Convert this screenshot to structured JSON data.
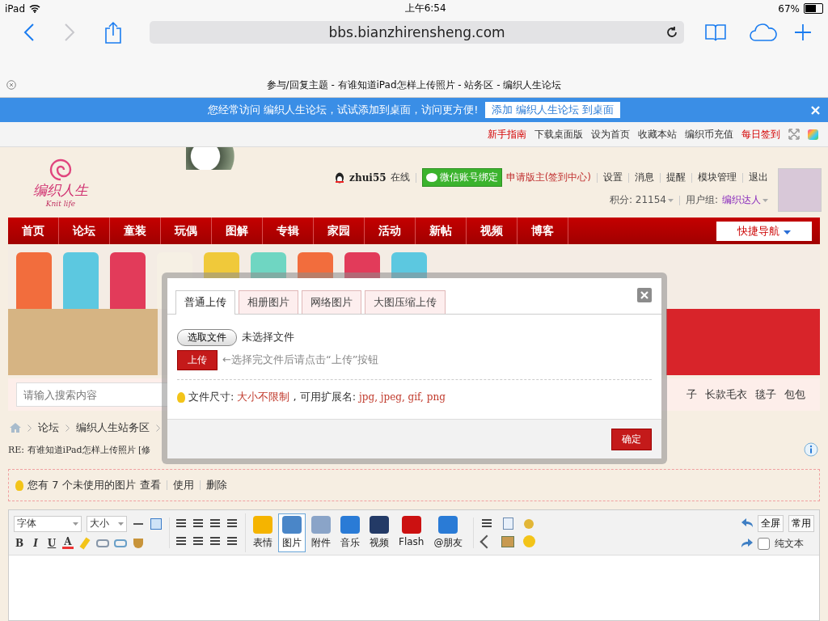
{
  "status_bar": {
    "device": "iPad",
    "time": "上午6:54",
    "battery": "67%"
  },
  "browser": {
    "url": "bbs.bianzhirensheng.com",
    "page_title": "参与/回复主题 - 有谁知道iPad怎样上传照片 - 站务区 - 编织人生论坛"
  },
  "add_prompt": {
    "text": "您经常访问 编织人生论坛，试试添加到桌面，访问更方便!",
    "button": "添加 编织人生论坛 到桌面"
  },
  "top_links": [
    {
      "label": "新手指南",
      "highlighted": true
    },
    {
      "label": "下载桌面版",
      "highlighted": false
    },
    {
      "label": "设为首页",
      "highlighted": false
    },
    {
      "label": "收藏本站",
      "highlighted": false
    },
    {
      "label": "编织币充值",
      "highlighted": false
    },
    {
      "label": "每日签到",
      "highlighted": true
    }
  ],
  "logo": {
    "title": "编织人生",
    "subtitle": "Knit life"
  },
  "user": {
    "name": "zhui55",
    "status": "在线",
    "wechat": "微信账号绑定",
    "links": [
      "申请版主(签到中心)",
      "设置",
      "消息",
      "提醒",
      "模块管理",
      "退出"
    ],
    "points": "积分: 21154",
    "group_label": "用户组:",
    "group": "编织达人"
  },
  "nav": {
    "items": [
      "首页",
      "论坛",
      "童装",
      "玩偶",
      "图解",
      "专辑",
      "家园",
      "活动",
      "新帖",
      "视频",
      "博客"
    ],
    "quick": "快捷导航"
  },
  "search": {
    "placeholder": "请输入搜索内容",
    "tags": [
      "子",
      "长款毛衣",
      "毯子",
      "包包"
    ]
  },
  "breadcrumb": [
    "论坛",
    "编织人生站务区"
  ],
  "post_title": "RE: 有谁知道iPad怎样上传照片 [修",
  "notice": {
    "text": "您有 7 个未使用的图片",
    "actions": [
      "查看",
      "使用",
      "删除"
    ]
  },
  "editor": {
    "font": "字体",
    "size": "大小",
    "format_buttons": [
      "B",
      "I",
      "U",
      "A"
    ],
    "tools": [
      {
        "label": "表情",
        "selected": false
      },
      {
        "label": "图片",
        "selected": true
      },
      {
        "label": "附件",
        "selected": false
      },
      {
        "label": "音乐",
        "selected": false
      },
      {
        "label": "视频",
        "selected": false
      },
      {
        "label": "Flash",
        "selected": false
      },
      {
        "label": "@朋友",
        "selected": false
      }
    ],
    "fullscreen": "全屏",
    "common": "常用",
    "plain_text": {
      "label": "纯文本",
      "checked": false
    }
  },
  "dialog": {
    "tabs": [
      {
        "label": "普通上传",
        "selected": true
      },
      {
        "label": "相册图片",
        "selected": false
      },
      {
        "label": "网络图片",
        "selected": false
      },
      {
        "label": "大图压缩上传",
        "selected": false
      }
    ],
    "choose_button": "选取文件",
    "no_file": "未选择文件",
    "upload_button": "上传",
    "upload_hint": "←选择完文件后请点击“上传”按钮",
    "size_label": "文件尺寸:",
    "size_value": "大小不限制",
    "ext_label": ", 可用扩展名:",
    "ext_value": "jpg, jpeg, gif, png",
    "ok": "确定"
  }
}
